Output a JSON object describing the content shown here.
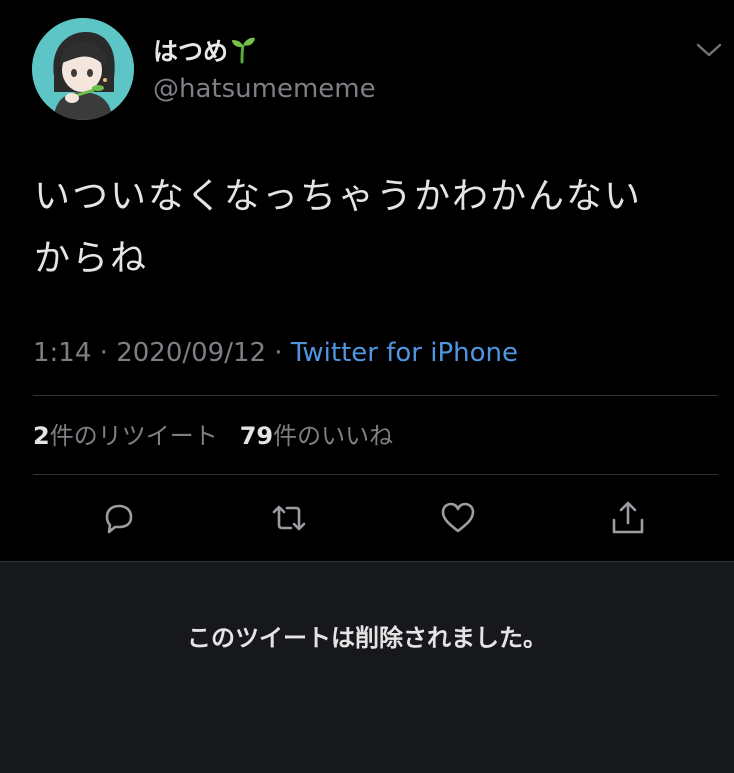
{
  "tweet": {
    "author": {
      "display_name": "はつめ",
      "display_name_emoji": "sprout-icon",
      "handle": "@hatsumememe",
      "avatar_bg": "#5ec5c6"
    },
    "text_line1": "いついなくなっちゃうかわかんない",
    "text_line2": "からね",
    "time": "1:14",
    "sep1": " · ",
    "date": "2020/09/12",
    "sep2": " · ",
    "source": "Twitter for iPhone",
    "retweet_count": "2",
    "retweet_label": "件のリツイート",
    "like_count": "79",
    "like_label": "件のいいね"
  },
  "actions": [
    "reply-icon",
    "retweet-icon",
    "like-icon",
    "share-icon"
  ],
  "deleted_notice": "このツイートは削除されました。",
  "colors": {
    "background": "#000000",
    "link": "#4f95e0",
    "muted": "#7c7f84",
    "panel": "#16181c"
  }
}
